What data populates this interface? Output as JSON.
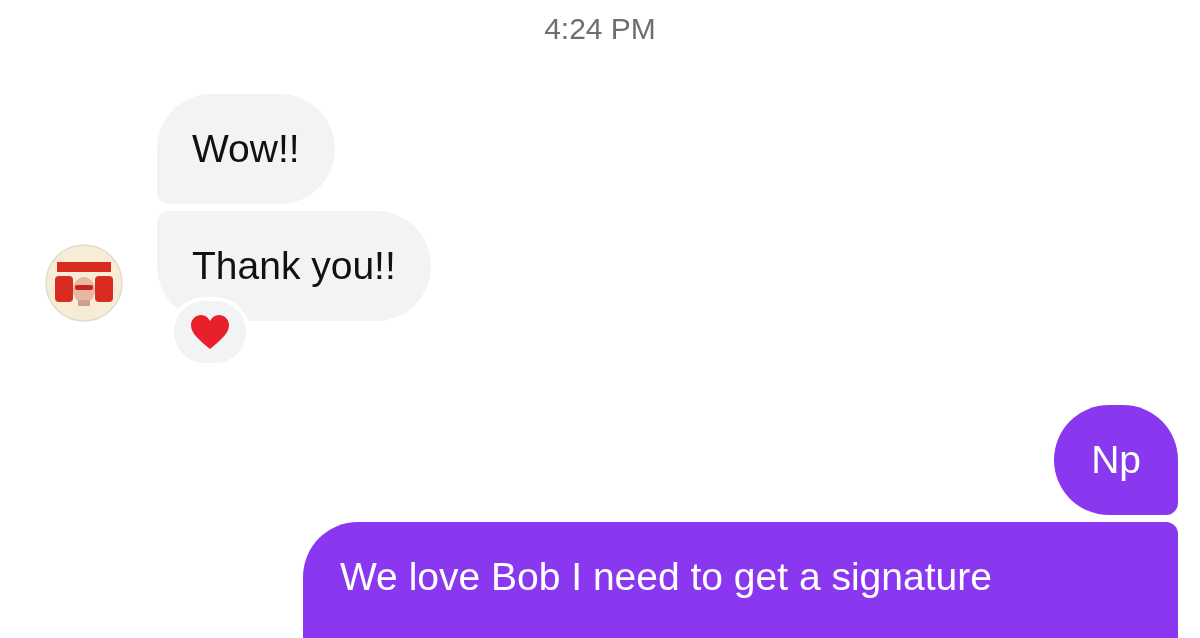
{
  "timestamp": "4:24 PM",
  "incoming": {
    "messages": [
      {
        "text": "Wow!!",
        "reacted": false
      },
      {
        "text": "Thank you!!",
        "reacted": true
      }
    ]
  },
  "outgoing": {
    "messages": [
      {
        "text": "Np"
      },
      {
        "text": "We love Bob I need to get a signature"
      }
    ]
  }
}
